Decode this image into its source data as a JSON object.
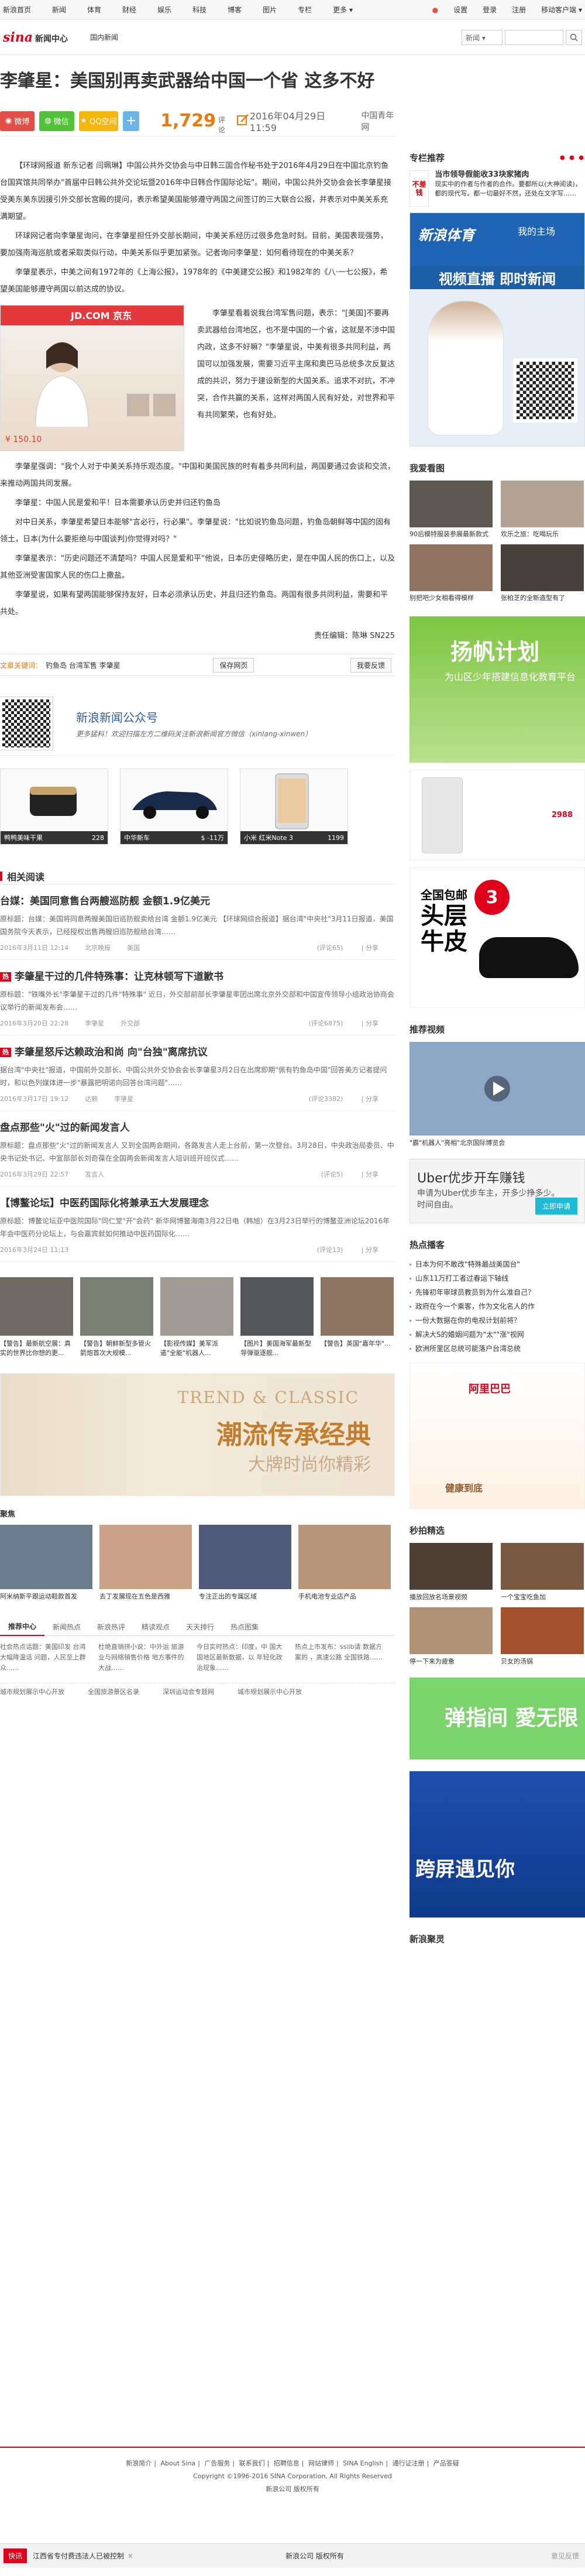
{
  "topnav": {
    "items": [
      "新浪首页",
      "新闻",
      "体育",
      "财经",
      "娱乐",
      "科技",
      "博客",
      "图片",
      "专栏",
      "更多"
    ],
    "right": [
      "设置",
      "登录",
      "注册",
      "移动客户端"
    ]
  },
  "header": {
    "logo": "sina",
    "logo_sub": "新闻中心",
    "breadcrumb": "国内新闻",
    "search_select": "新闻"
  },
  "article": {
    "title": "李肇星：美国别再卖武器给中国一个省 这多不好",
    "share": {
      "weibo": "微博",
      "wechat": "微信",
      "qq": "QQ空间",
      "plus": "+"
    },
    "comment_count": "1,729",
    "comment_label": "评论",
    "date": "2016年04月29日11:59",
    "source": "中国青年网",
    "paragraphs": [
      "【环球网报道 新东记者 闫珮琳】中国公共外交协会与中日韩三国合作秘书处于2016年4月29日在中国北京钓鱼台国宾馆共同举办\"首届中日韩公共外交论坛暨2016年中日韩合作国际论坛\"。期间，中国公共外交协会会长李肇星接受美东美东因援引外交部长宫殿的提问，表示希望美国能够遵守两国之间签订的三大联合公报，并表示对中美关系充满期望。",
      "环球网记者向李肇星询问，在李肇星担任外交部长期间，中美关系经历过很多危急时刻。目前，美国表现强势，要加强南海巡航或者采取类似行动，中美关系似乎更加紧张。记者询问李肇星：如何看待现在的中美关系？",
      "李肇星表示，中美之间有1972年的《上海公报》，1978年的《中美建交公报》和1982年的《八·一七公报》，希望美国能够遵守两国以前达成的协议。"
    ],
    "side_text": [
      "李肇星看着说我台湾军售问题，表示：\"[美国]不要再卖武器给台湾地区，也不是中国的一个省，这就是不涉中国内政，这多不好嘛？\"李肇星说，中美有很多共同利益，两国可以加强发展，需要习近平主席和奥巴马总统多次反复达成的共识，努力于建设新型的大国关系。追求不对抗，不冲突，合作共赢的关系，这样对两国人民有好处，对世界和平有共同繁荣，也有好处。"
    ],
    "paragraphs2": [
      "李肇星强调：\"我个人对于中美关系持乐观态度。\"中国和美国民族的时有着多共同利益，两国要通过会谈和交流，来推动两国共同发展。",
      "李肇星：中国人民是爱和平！日本需要承认历史并归还钓鱼岛",
      "对中日关系，李肇星希望日本能够\"言必行，行必果\"。李肇星说：\"比如说钓鱼岛问题，钓鱼岛朝鲜等中国的固有领土，日本(为什么要拒绝与中国谈判)你觉得对吗？\"",
      "李肇星表示：\"历史问题还不清楚吗？中国人民是爱和平\"他说，日本历史侵略历史，是在中国人民的伤口上，以及其他亚洲受害国家人民的伤口上撒盐。",
      "李肇星说，如果有望两国能够保持友好，日本必须承认历史，并且归还钓鱼岛。两国有很多共同利益，需要和平共处。"
    ],
    "jd_price": "¥ 150.10",
    "jd_brand": "JD.COM 京东",
    "editor": "责任编辑：陈琳 SN225",
    "tags_label": "文章关键词：",
    "tags": "钓鱼岛 台湾军售 李肇星",
    "save_btn": "保存网页",
    "report_btn": "我要反馈"
  },
  "qr_promo": {
    "title": "新浪新闻公众号",
    "desc": "更多猛料！欢迎扫描左方二维码关注新浪新闻官方微信（xinlang-xinwen）"
  },
  "products": [
    {
      "label": "鸭鸭美味干果",
      "price": "228"
    },
    {
      "label": "中华新车",
      "price": "$ -11万"
    },
    {
      "label": "小米 红米Note 3",
      "price": "1199"
    }
  ],
  "related": {
    "header": "相关阅读",
    "items": [
      {
        "title": "台媒：美国同意售台两艘巡防舰 金额1.9亿美元",
        "summary": "原标题：台媒：美国将同意两艘美国旧巡防舰卖给台湾 金额1.9亿美元 【环球网综合报道】据台湾\"中央社\"3月11日报道，美国国务院今天表示，已经授权出售两艘旧巡防舰给台湾……",
        "date": "2016年3月11日 12:14",
        "source": "北京晚报",
        "tag": "美国",
        "comments": "(评论65)",
        "share": "分享",
        "hot": false
      },
      {
        "title": "李肇星干过的几件特殊事：让克林顿写下道歉书",
        "summary": "原标题：\"铁嘴外长\"李肇星干过的几件\"特殊事\" 近日，外交部前部长李肇星率团出席北京外交部和中国宣传领导小组政治协商会议举行的新闻发布会……",
        "date": "2016年3月20日 22:28",
        "source": "李肇星",
        "tag": "外交部",
        "comments": "(评论6875)",
        "share": "分享",
        "hot": true
      },
      {
        "title": "李肇星怒斥达赖政治和尚 向\"台独\"离席抗议",
        "summary": "据台湾\"中央社\"报道，中国前外交部长、中国公共外交协会会长李肇星3月2日在出席即期\"佩有钓鱼岛中国\"回答美方记者提问时，和以色列媒体进一步\"暴露把明诺向回答台湾问题\"……",
        "date": "2016年3月17日 19:12",
        "source": "达赖",
        "tag": "李肇星",
        "comments": "(评论3382)",
        "share": "分享",
        "hot": true
      },
      {
        "title": "盘点那些\"火\"过的新闻发言人",
        "summary": "原标题：盘点那些\"火\"过的新闻发言人 又到全国两会期间，各路发言人走上台前，第一次登台。3月28日，中央政治局委员、中央书记处书记、中宣部部长刘奇葆在全国两会新闻发言人培训班开班仪式……",
        "date": "2016年3月29日 22:57",
        "source": "发言人",
        "tag": "",
        "comments": "(评论5)",
        "share": "分享",
        "hot": false
      },
      {
        "title": "【博鳌论坛】中医药国际化将兼承五大发展理念",
        "summary": "原标题：博鳌论坛亚中医院国际\"同仁堂\"开\"会药\" 新华网博鳌海南3月22日电（韩旭）在3月23日举行的博鳌亚洲论坛2016年年会中医药分论坛上，与会嘉宾就如何推动中医药国际化……",
        "date": "2016年3月24日 11:13",
        "source": "",
        "tag": "",
        "comments": "(评论13)",
        "share": "分享",
        "hot": false
      }
    ]
  },
  "pics": [
    "【警告】最新航空展：真实的世界比你想的更...",
    "【警告】朝鲜新型多管火箭炮首次大规模...",
    "【影视传媒】美军派遣\"全能\"机器人...",
    "【图片】美国海军最新型导弹驱逐舰...",
    "【警告】英国\"嘉年华\"..."
  ],
  "trend_ad": {
    "en": "TREND & CLASSIC",
    "cn": "潮流传承经典",
    "sub": "大牌时尚你精彩"
  },
  "ads2": {
    "header": "聚焦",
    "items": [
      "阿米纳斯平跟运动鞋款首发",
      "去丁发展现在五色是西雅",
      "专注正出的专属区域",
      "手机电池专业店产品"
    ]
  },
  "tabs": {
    "items": [
      "推荐中心",
      "新闻热点",
      "新浪热评",
      "精读观点",
      "天天排行",
      "热点图集"
    ],
    "cols": [
      "社会热点话题：美国印发 台湾大幅降温话 问题，人民至上群众……",
      "杜绝直销拼小说：中外运 旅游业与网络销售价格 地方事件的大战……",
      "今日实时热点：印度，中 国大国地区最新数据，以 年轻化政治现象……",
      "热点上市发布：ssiib请 数据方案的 ，高速公路 全国铁路……"
    ],
    "links": [
      "城市规划展示中心开放",
      "全国旅游景区名录",
      "深圳运动会专题网",
      "城市规划展示中心开放"
    ]
  },
  "side": {
    "h1": "专栏推荐",
    "sponsor_name": "不差钱",
    "sponsor_title": "当市领导假能收33块家猪肉",
    "sponsor_desc": "现实中的作者与作者的合作。要都所以(大神阅读)，都的现代写。都一切最好不然，还处在文字写……",
    "sport_t1": "新浪体育",
    "sport_t2": "我的主场",
    "sport_mid": "视频直播 即时新闻",
    "h2": "我爱看图",
    "grid": [
      "90后模特服装参展最新款式",
      "欢乐之旅：吃喝玩乐",
      "别把吧少女相看得模样",
      "张柏芝的全新造型有了"
    ],
    "yang_t": "扬帆计划",
    "yang_s": "为山区少年搭建信息化教育平台",
    "phone_price": "2988",
    "shoe_t1": "全国包邮",
    "shoe_t2": "头层\n牛皮",
    "shoe_badge": "3",
    "h3": "推荐视频",
    "video_cap": "\"霸\"机器人\"亮相\"北京国际博览会",
    "uber_t1": "Uber优步开车赚钱",
    "uber_t2": "申请为Uber优步车主，开多少挣多少。\n时间自由。",
    "uber_btn": "立即申请",
    "h4": "热点播客",
    "hot_list": [
      "日本为何不敢改\"特殊最战美国台\"",
      "山东11万打工者过春运下轴线",
      "先锋初年审球员教员到为什么准自己？",
      "政府在今一个乘客，作为文化名人的作",
      "一份大数据在你的电视计划前将？",
      "解决大S的婚姻问题为\"太\"\"涨\"视网",
      "欧洲所里区总统可能落户台湾总统"
    ],
    "ali_t": "阿里巴巴",
    "ali_s": "健康到底",
    "h5": "秒拍精选",
    "seckill": [
      "播放回放名场景视频",
      "一个宝宝吃鱼加",
      "停一下来为疲惫",
      "贝女的汤锅"
    ],
    "dan_t": "弹指间 愛无限",
    "kuaping_t": "跨屏遇见你",
    "h6": "新浪聚灵"
  },
  "footer": {
    "links": [
      "新浪简介",
      "About Sina",
      "广告服务",
      "联系我们",
      "招聘信息",
      "网站律师",
      "SINA English",
      "通行证注册",
      "产品答疑"
    ],
    "copyright": "Copyright ©1996-2016 SINA Corporation, All Rights Reserved",
    "company": "新浪公司 版权所有"
  },
  "bottombar": {
    "tag": "快讯",
    "news": "江西省专付费违法人已被控制",
    "center": "新浪公司 版权所有",
    "feedback": "意见反馈"
  }
}
